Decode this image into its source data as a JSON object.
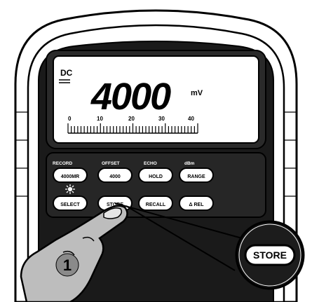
{
  "display": {
    "reading": "4000",
    "mode_indicator": "DC",
    "unit": "mV",
    "scale_labels": [
      "0",
      "10",
      "20",
      "30",
      "40"
    ]
  },
  "keypad": {
    "row1": [
      {
        "top_label": "RECORD",
        "key": "4000MR"
      },
      {
        "top_label": "OFFSET",
        "key": "4000"
      },
      {
        "top_label": "ECHO",
        "key": "HOLD"
      },
      {
        "top_label": "dBm",
        "key": "RANGE"
      }
    ],
    "row2": [
      {
        "top_label": "",
        "key": "SELECT"
      },
      {
        "top_label": "",
        "key": "STORE"
      },
      {
        "top_label": "",
        "key": "RECALL"
      },
      {
        "top_label": "",
        "key": "Δ REL"
      }
    ]
  },
  "callout": {
    "label": "STORE",
    "step_number": "1"
  }
}
